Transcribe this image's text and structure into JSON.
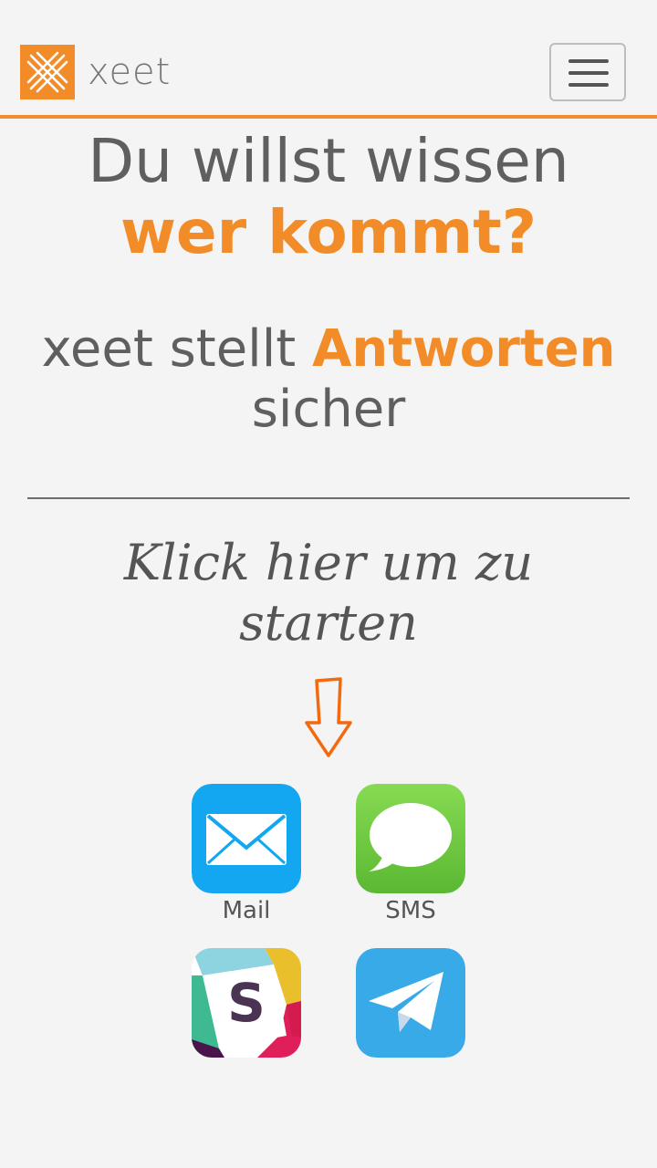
{
  "brand": {
    "name": "xeet",
    "logo_icon": "xeet-logo-icon",
    "color": "#f28c28"
  },
  "nav": {
    "menu_icon": "hamburger-menu-icon"
  },
  "hero": {
    "line1": "Du willst wissen",
    "line2": "wer kommt?",
    "sub_prefix": "xeet stellt",
    "sub_accent": "Antworten",
    "sub_suffix": "sicher"
  },
  "cta": {
    "text": "Klick hier um zu starten",
    "arrow_icon": "arrow-down-icon"
  },
  "apps": [
    {
      "label": "Mail",
      "icon": "mail-icon",
      "color": "#12a7f0"
    },
    {
      "label": "SMS",
      "icon": "sms-icon",
      "color": "#6ac53b"
    },
    {
      "label": "",
      "icon": "slack-icon",
      "color": "#4a154b"
    },
    {
      "label": "",
      "icon": "telegram-icon",
      "color": "#38aae8"
    }
  ],
  "colors": {
    "accent": "#f28c28",
    "text": "#5f5f5f",
    "background": "#f4f4f4"
  }
}
